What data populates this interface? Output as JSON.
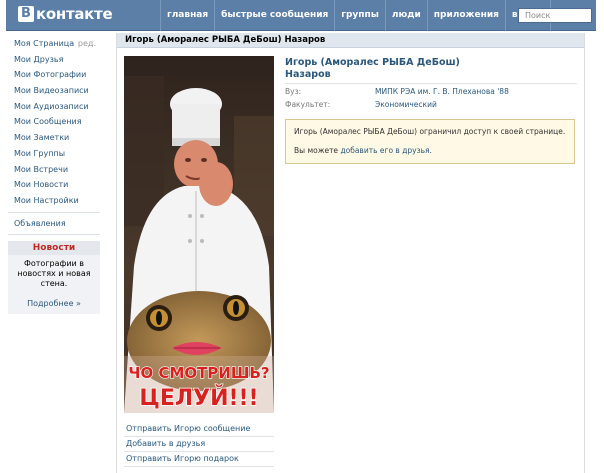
{
  "header": {
    "logo_letter": "B",
    "logo_text": "контакте",
    "nav": [
      "главная",
      "быстрые сообщения",
      "группы",
      "люди",
      "приложения",
      "выйти"
    ],
    "search_placeholder": "Поиск"
  },
  "sidebar": {
    "items": [
      "Моя Страница",
      "Мои Друзья",
      "Мои Фотографии",
      "Мои Видеозаписи",
      "Мои Аудиозаписи",
      "Мои Сообщения",
      "Мои Заметки",
      "Мои Группы",
      "Мои Встречи",
      "Мои Новости",
      "Мои Настройки"
    ],
    "edit_label": "ред.",
    "ads": "Объявления",
    "news": {
      "title": "Новости",
      "body": "Фотографии в новостях и новая стена.",
      "more": "Подробнее »"
    }
  },
  "page": {
    "title": "Игорь (Аморалес РЫБА ДеБош) Назаров",
    "name_line1": "Игорь (Аморалес РЫБА ДеБош)",
    "name_line2": "Назаров",
    "info": [
      {
        "label": "Вуз:",
        "value": "МИПК РЭА им. Г. В. Плеханова '88"
      },
      {
        "label": "Факультет:",
        "value": "Экономический"
      }
    ],
    "notice": {
      "text": "Игорь (Аморалес РЫБА ДеБош) ограничил доступ к своей странице.",
      "pre": "Вы можете ",
      "link": "добавить его в друзья",
      "post": "."
    },
    "photo_caption_top": "ЧО СМОТРИШЬ?",
    "photo_caption_bottom": "ЦЕЛУЙ!!!",
    "actions": [
      "Отправить Игорю сообщение",
      "Добавить в друзья",
      "Отправить Игорю подарок"
    ]
  },
  "colors": {
    "header": "#5b7fa6",
    "link": "#2b587a",
    "notice_bg": "#fff9e6",
    "caption_red": "#d8221f"
  }
}
